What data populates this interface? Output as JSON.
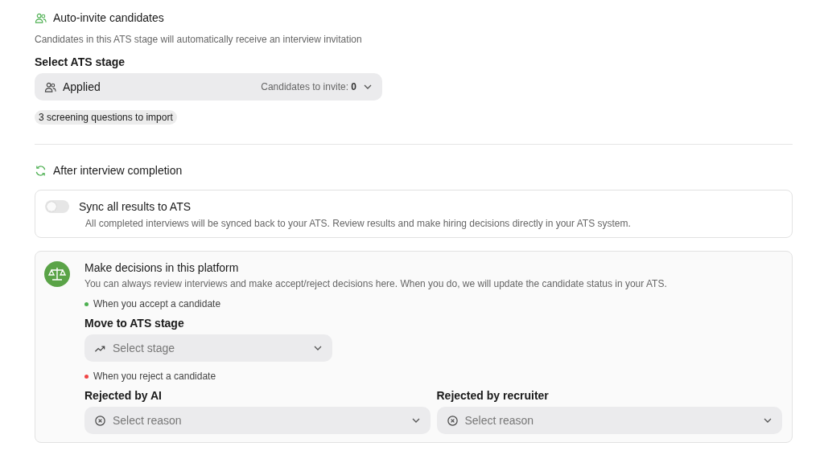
{
  "auto_invite": {
    "title": "Auto-invite candidates",
    "description": "Candidates in this ATS stage will automatically receive an interview invitation",
    "stage_label": "Select ATS stage",
    "stage_select": {
      "value": "Applied",
      "count": "Candidates to invite: **0**"
    },
    "chip": "3 screening questions to import"
  },
  "after_interview": {
    "title": "After interview completion",
    "sync": {
      "on": false,
      "title": "Sync all results to ATS",
      "description": "All completed interviews will be synced back to your ATS. Review results and make hiring decisions directly in your ATS system."
    },
    "decisions": {
      "title": "Make decisions in this platform",
      "description": "You can always review interviews and make accept/reject decisions here. When you do, we will update the candidate status in your ATS.",
      "accept": {
        "note": "When you accept a candidate",
        "color": "#4caf50",
        "label": "Move to ATS stage",
        "placeholder": "Select stage"
      },
      "reject": {
        "note": "When you reject a candidate",
        "color": "#f04444",
        "fields": [
          {
            "label": "Rejected by AI",
            "placeholder": "Select reason"
          },
          {
            "label": "Rejected by recruiter",
            "placeholder": "Select reason"
          }
        ]
      }
    }
  }
}
